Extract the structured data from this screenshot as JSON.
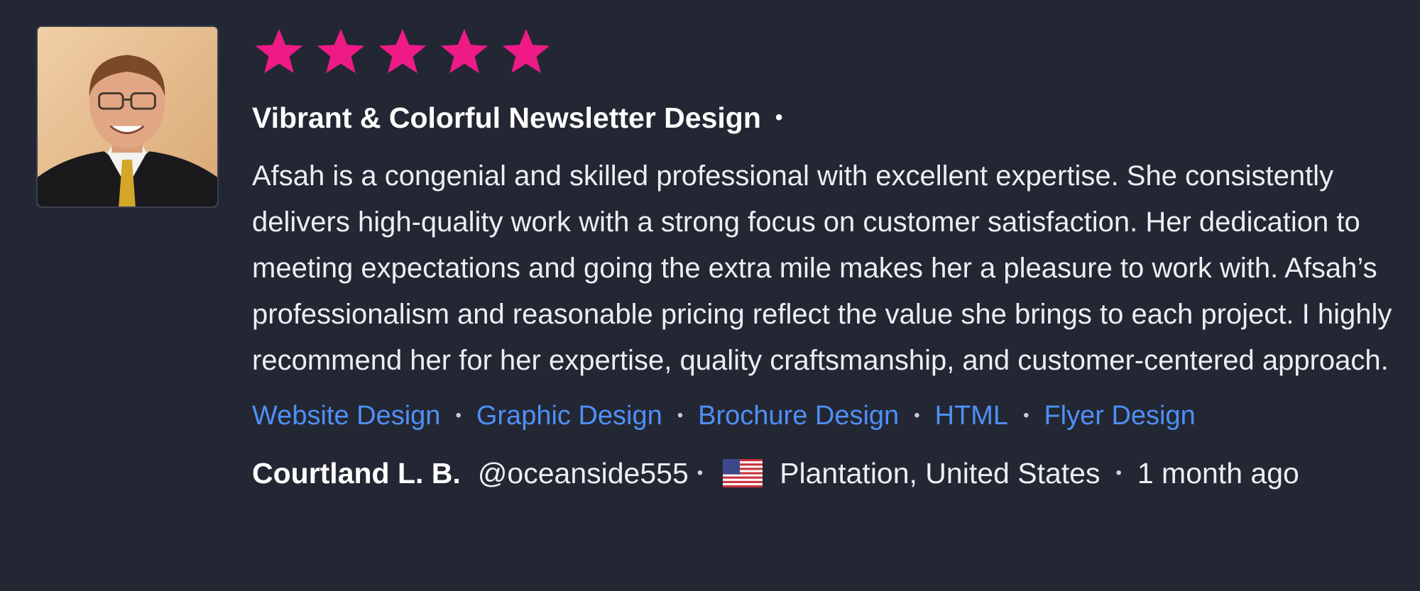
{
  "review": {
    "rating": 5,
    "rating_max": 5,
    "star_color": "#ee1a86",
    "title": "Vibrant & Colorful Newsletter Design",
    "title_separator": "•",
    "body": "Afsah is a congenial and skilled professional with excellent expertise. She consistently delivers high-quality work with a strong focus on customer satisfaction. Her dedication to meeting expectations and going the extra mile makes her a pleasure to work with. Afsah’s professionalism and reasonable pricing reflect the value she brings to each project. I highly recommend her for her expertise, quality craftsmanship, and customer-centered approach.",
    "tags": [
      "Website Design",
      "Graphic Design",
      "Brochure Design",
      "HTML",
      "Flyer Design"
    ],
    "tag_color": "#4f8ff7",
    "separator": "•",
    "reviewer": {
      "name": "Courtland L. B.",
      "handle": "@oceanside555",
      "flag_icon": "us-flag-icon",
      "location": "Plantation, United States",
      "time_ago": "1 month ago"
    }
  }
}
